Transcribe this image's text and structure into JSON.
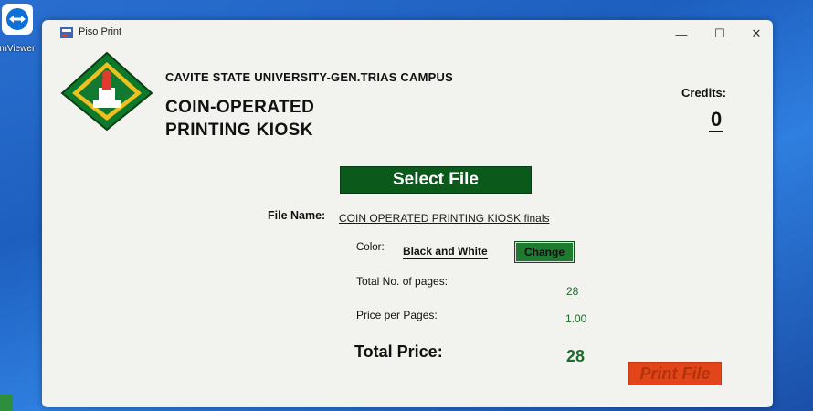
{
  "desktop": {
    "shortcut_label": "amViewer"
  },
  "window": {
    "title": "Piso Print",
    "controls": {
      "minimize": "—",
      "maximize": "☐",
      "close": "✕"
    }
  },
  "header": {
    "university": "CAVITE STATE UNIVERSITY-GEN.TRIAS CAMPUS",
    "kiosk_line1": "COIN-OPERATED",
    "kiosk_line2": "PRINTING KIOSK"
  },
  "credits": {
    "label": "Credits:",
    "value": "0"
  },
  "actions": {
    "select_file": "Select File",
    "change": "Change",
    "print_file": "Print File"
  },
  "file": {
    "name_label": "File Name:",
    "name_value": "COIN OPERATED PRINTING KIOSK finals"
  },
  "options": {
    "color_label": "Color:",
    "color_value": "Black and White",
    "pages_label": "Total No. of pages:",
    "pages_value": "28",
    "price_per_page_label": "Price  per Pages:",
    "price_per_page_value": "1.00",
    "total_label": "Total Price:",
    "total_value": "28"
  },
  "colors": {
    "accent_green": "#0b5a1c",
    "value_green": "#1e6b2c",
    "print_orange": "#e2451a"
  }
}
